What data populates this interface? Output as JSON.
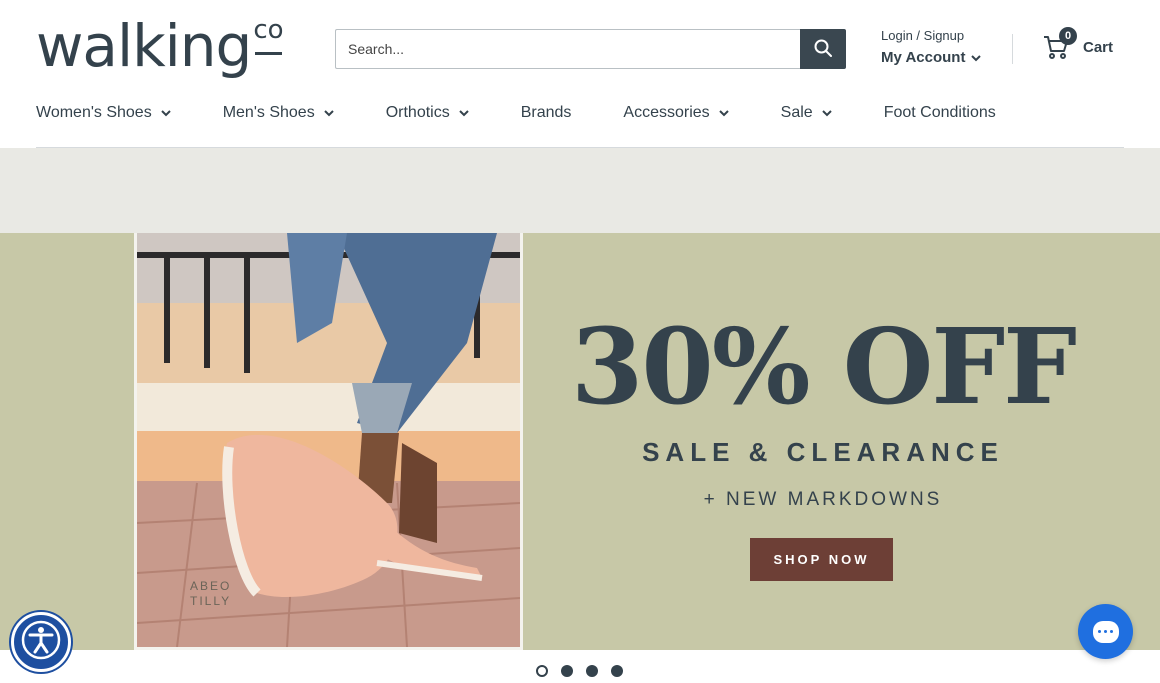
{
  "header": {
    "logo_main": "walking",
    "logo_sup": "co",
    "search": {
      "placeholder": "Search..."
    },
    "account": {
      "login_label": "Login / Signup",
      "my_account_label": "My Account"
    },
    "cart": {
      "count": "0",
      "label": "Cart"
    }
  },
  "nav": {
    "items": [
      {
        "label": "Women's Shoes",
        "has_dropdown": true
      },
      {
        "label": "Men's Shoes",
        "has_dropdown": true
      },
      {
        "label": "Orthotics",
        "has_dropdown": true
      },
      {
        "label": "Brands",
        "has_dropdown": false
      },
      {
        "label": "Accessories",
        "has_dropdown": true
      },
      {
        "label": "Sale",
        "has_dropdown": true
      },
      {
        "label": "Foot Conditions",
        "has_dropdown": false
      }
    ]
  },
  "banner": {
    "photo_caption_line1": "ABEO",
    "photo_caption_line2": "TILLY",
    "headline": "30% OFF",
    "subheadline": "SALE & CLEARANCE",
    "subheadline2": "+ NEW MARKDOWNS",
    "cta_label": "SHOP NOW"
  },
  "carousel": {
    "slide_count": 4,
    "active_index": 0
  },
  "colors": {
    "brand_text": "#34424c",
    "banner_bg": "#c7c8a7",
    "strip_bg": "#e9e9e4",
    "cta_bg": "#6d3f36",
    "chat_bg": "#1f6fe0",
    "accessibility_bg": "#1e4fa0"
  },
  "icons": {
    "search": "search-icon",
    "cart": "cart-icon",
    "chevron": "chevron-down-icon",
    "accessibility": "accessibility-icon",
    "chat": "chat-icon"
  }
}
